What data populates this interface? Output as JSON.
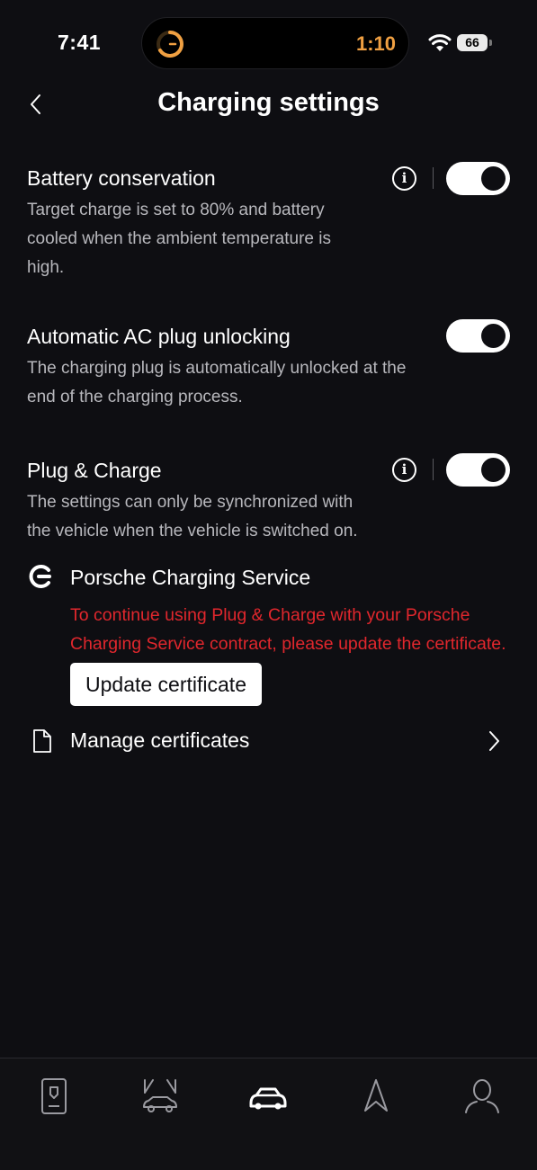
{
  "status_bar": {
    "time": "7:41",
    "island_timer": "1:10",
    "battery_level": "66",
    "wifi_icon": "wifi-icon"
  },
  "header": {
    "title": "Charging settings",
    "back_icon": "chevron-left-icon"
  },
  "settings": [
    {
      "title": "Battery conservation",
      "description": "Target charge is set to 80% and battery cooled when the ambient temperature is high.",
      "enabled": true,
      "has_info": true
    },
    {
      "title": "Automatic AC plug unlocking",
      "description": "The charging plug is automatically unlocked at the end of the charging process.",
      "enabled": true,
      "has_info": false
    },
    {
      "title": "Plug & Charge",
      "description": "The settings can only be synchronized with the vehicle when the vehicle is switched on.",
      "enabled": true,
      "has_info": true
    }
  ],
  "charging_service": {
    "icon": "porsche-charging-service-icon",
    "title": "Porsche Charging Service",
    "warning": "To continue using Plug & Charge with your Porsche Charging Service contract, please update the certificate.",
    "update_button": "Update certificate"
  },
  "manage_certificates": {
    "icon": "document-icon",
    "label": "Manage certificates"
  },
  "tab_bar": {
    "tabs": [
      "vehicle-key-icon",
      "car-lift-icon",
      "car-icon",
      "navigation-icon",
      "profile-icon"
    ],
    "active_index": 2
  },
  "colors": {
    "background": "#0e0e12",
    "warning": "#e1272d",
    "timer_accent": "#f0a042"
  }
}
